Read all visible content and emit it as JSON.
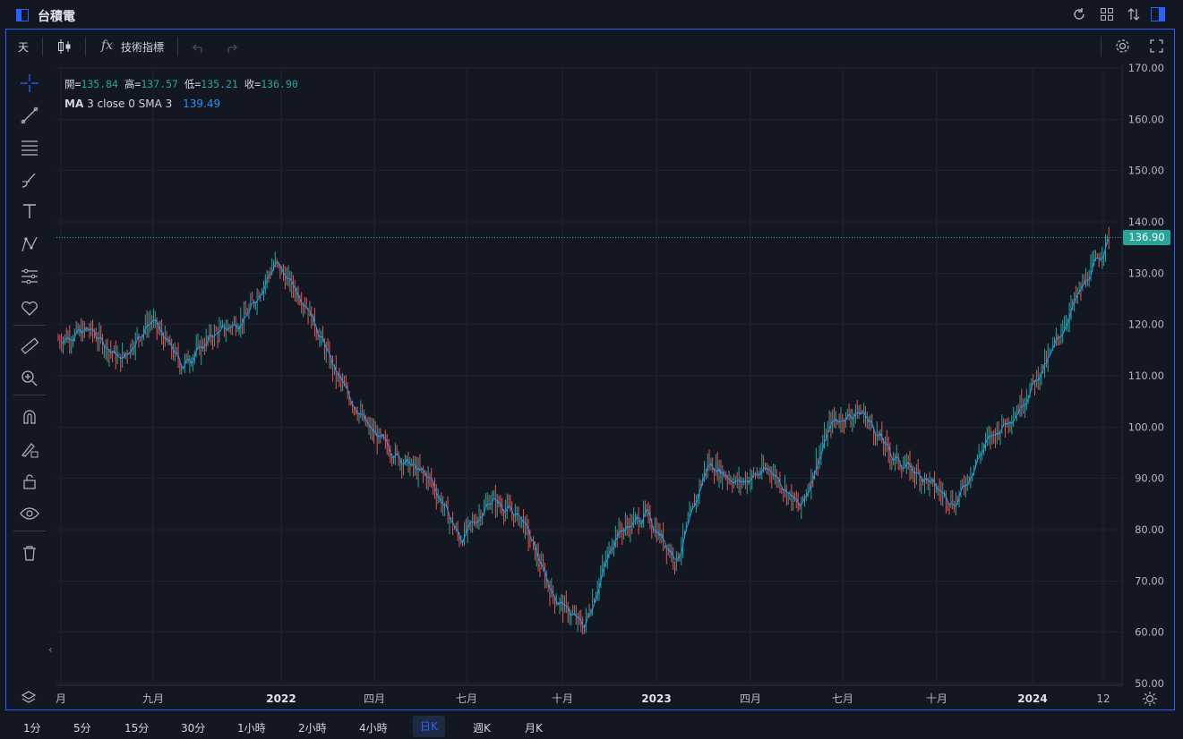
{
  "window": {
    "title": "台積電"
  },
  "toolbar": {
    "interval": "天",
    "indicators_label": "技術指標"
  },
  "legend": {
    "open_label": "開=",
    "open": "135.84",
    "high_label": "高=",
    "high": "137.57",
    "low_label": "低=",
    "low": "135.21",
    "close_label": "收=",
    "close": "136.90",
    "ma_name": "MA",
    "ma_params": "3 close 0 SMA 3",
    "ma_value": "139.49"
  },
  "price_axis": {
    "ticks": [
      "170.00",
      "160.00",
      "150.00",
      "140.00",
      "130.00",
      "120.00",
      "110.00",
      "100.00",
      "90.00",
      "80.00",
      "70.00",
      "60.00",
      "50.00"
    ],
    "last_price_badge": "136.90"
  },
  "time_axis": {
    "labels": [
      "月",
      "九月",
      "2022",
      "四月",
      "七月",
      "十月",
      "2023",
      "四月",
      "七月",
      "十月",
      "2024",
      "12"
    ]
  },
  "timeframes": [
    "1分",
    "5分",
    "15分",
    "30分",
    "1小時",
    "2小時",
    "4小時",
    "日K",
    "週K",
    "月K"
  ],
  "active_timeframe": "日K",
  "colors": {
    "up": "#26a69a",
    "down": "#ef5350",
    "ma": "#2196f3",
    "accent": "#2962ff",
    "badge": "#26a69a",
    "background": "#131722",
    "grid": "#1f2330"
  },
  "chart_data": {
    "type": "candlestick",
    "title": "",
    "ylim": [
      50,
      170
    ],
    "series": [
      {
        "name": "MA",
        "values_note": "3-day SMA of close"
      }
    ],
    "x": [
      "2021-07",
      "2021-08",
      "2021-09",
      "2021-10",
      "2021-11",
      "2021-12",
      "2022-01",
      "2022-02",
      "2022-03",
      "2022-04",
      "2022-05",
      "2022-06",
      "2022-07",
      "2022-08",
      "2022-09",
      "2022-10",
      "2022-11",
      "2022-12",
      "2023-01",
      "2023-02",
      "2023-03",
      "2023-04",
      "2023-05",
      "2023-06",
      "2023-07",
      "2023-08",
      "2023-09",
      "2023-10",
      "2023-11",
      "2023-12",
      "2024-01",
      "2024-02",
      "2024-03"
    ],
    "close": [
      117,
      119,
      113,
      121,
      112,
      118,
      121,
      132,
      124,
      110,
      100,
      94,
      90,
      78,
      86,
      82,
      67,
      61,
      79,
      83,
      74,
      93,
      89,
      92,
      84,
      101,
      103,
      94,
      90,
      85,
      97,
      103,
      113,
      126,
      136.9
    ]
  }
}
